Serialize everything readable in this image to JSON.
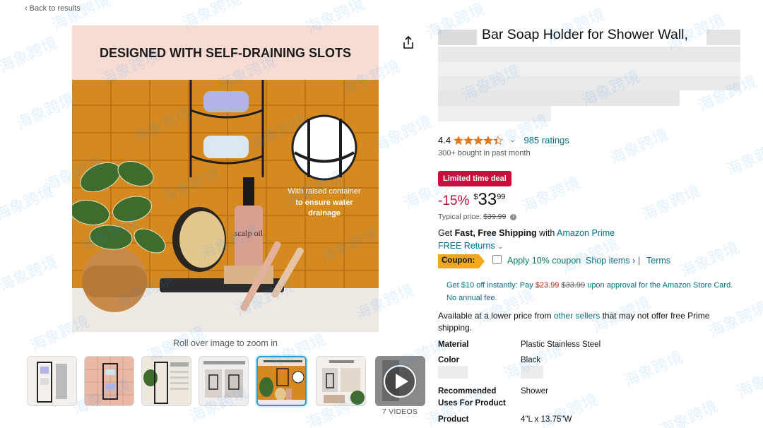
{
  "nav": {
    "back_label": "Back to results"
  },
  "image": {
    "headline": "DESIGNED WITH SELF-DRAINING SLOTS",
    "callout_line1": "With raised container",
    "callout_line2": "to ensure water",
    "callout_line3": "drainage",
    "bottle_label": "scalp oil",
    "zoom_hint": "Roll over image to zoom in"
  },
  "thumbnails": {
    "count": 7,
    "selected_index": 4,
    "videos_label": "7 VIDEOS"
  },
  "product": {
    "title_visible": "Bar Soap Holder for Shower Wall,",
    "rating": "4.4",
    "stars": 4.4,
    "ratings_count": "985 ratings",
    "bought": "300+ bought in past month"
  },
  "deal": {
    "badge": "Limited time deal",
    "discount": "-15%",
    "currency": "$",
    "price_whole": "33",
    "price_fraction": "99",
    "typical_label": "Typical price:",
    "typical_price": "$39.99"
  },
  "shipping": {
    "prefix": "Get ",
    "bold": "Fast, Free Shipping",
    "middle": " with ",
    "prime": "Amazon Prime",
    "returns": "FREE Returns"
  },
  "coupon": {
    "badge": "Coupon:",
    "apply": "Apply 10% coupon",
    "shop_items": "Shop items ›",
    "separator": "|",
    "terms": "Terms"
  },
  "card_offer": {
    "part1": "Get $10 off instantly: Pay ",
    "pay": "$23.99",
    "strike": "$33.99",
    "part2": " upon approval for the Amazon Store Card. No annual fee."
  },
  "lower_price": {
    "part1": "Available at a lower price from ",
    "link": "other sellers",
    "part2": " that may not offer free Prime shipping."
  },
  "specs": [
    {
      "label": "Material",
      "value": "Plastic Stainless Steel"
    },
    {
      "label": "Color",
      "value": "Black"
    },
    {
      "label": "Recommended Uses For Product",
      "value": "Shower"
    },
    {
      "label": "Product",
      "value": "4\"L x 13.75\"W"
    }
  ],
  "watermark_text": "海象跨境",
  "colors": {
    "link": "#007185",
    "deal_red": "#cc0c39",
    "coupon_orange": "#f4a81d",
    "star": "#de7921",
    "selected_border": "#2a9ccf"
  }
}
